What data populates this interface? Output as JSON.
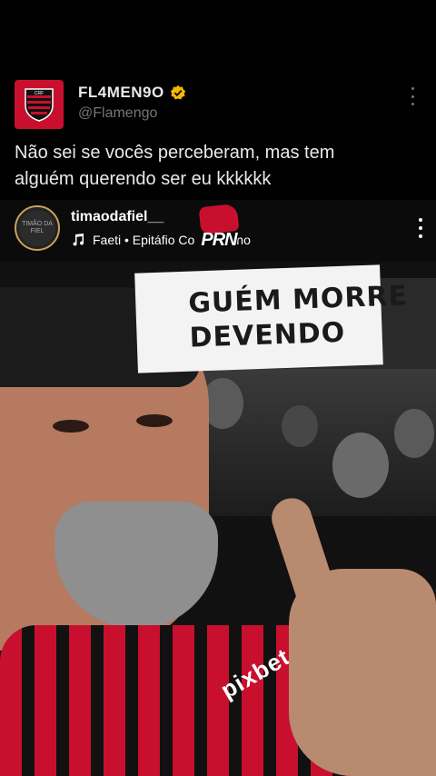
{
  "tweet": {
    "display_name": "FL4MEN9O",
    "handle": "@Flamengo",
    "text": "Não sei se vocês perceberam, mas tem alguém querendo ser eu kkkkkk",
    "avatar_icon": "flamengo-crest-icon",
    "verified_icon": "verified-badge-icon",
    "verified_color": "#f5b800"
  },
  "reel": {
    "username": "timaodafiel__",
    "avatar_text": "TIMÃO DA FIEL",
    "music": "Faeti • Epitáfio Co",
    "music_end": "no",
    "watermark": "PRN",
    "banner_line1": "GUÉM MORRE",
    "banner_line2": "DEVENDO",
    "shirt_brand": "pixbet"
  },
  "colors": {
    "background": "#000000",
    "text": "#e7e9ea",
    "secondary": "#71767b",
    "flamengo_red": "#c8102e"
  }
}
